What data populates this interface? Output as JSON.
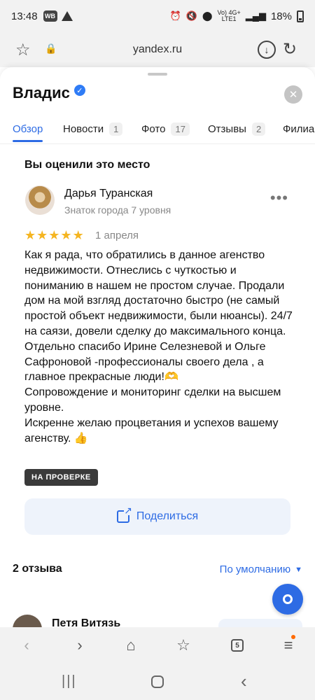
{
  "status_bar": {
    "time": "13:48",
    "app_badge": "WB",
    "network_label": "Vo) 4G+\nLTE1",
    "battery_percent": "18%"
  },
  "browser": {
    "url": "yandex.ru",
    "favorite_icon": "star-outline-icon",
    "lock_icon": "lock-icon",
    "download_icon": "download-icon",
    "reload_icon": "reload-icon"
  },
  "place": {
    "title": "Владис",
    "verified_icon": "verified-check-icon"
  },
  "tabs": [
    {
      "label": "Обзор",
      "count": "",
      "active": true
    },
    {
      "label": "Новости",
      "count": "1",
      "active": false
    },
    {
      "label": "Фото",
      "count": "17",
      "active": false
    },
    {
      "label": "Отзывы",
      "count": "2",
      "active": false
    },
    {
      "label": "Филиа",
      "count": "",
      "active": false
    }
  ],
  "my_review": {
    "heading": "Вы оценили это место",
    "author_name": "Дарья Туранская",
    "author_level": "Знаток города 7 уровня",
    "rating": 5,
    "date": "1 апреля",
    "text": "Как я рада, что обратились в данное агенство недвижимости. Отнеслись с чуткостью и пониманию в нашем не простом случае. Продали дом на мой взгляд достаточно быстро (не самый простой объект недвижимости, были нюансы). 24/7 на саязи, довели сделку до максимального конца. Отдельно спасибо Ирине Селезневой и Ольге Сафроновой -профессионалы своего дела , а главное прекрасные люди!🫶\nСопровождение и мониторинг сделки на высшем уровне.\nИскренне желаю процветания и успехов вашему агенству. 👍",
    "status_badge": "НА ПРОВЕРКЕ",
    "share_label": "Поделиться"
  },
  "reviews_section": {
    "count_label": "2 отзыва",
    "sort_label": "По умолчанию",
    "next_author": "Петя Витязь"
  },
  "colors": {
    "accent": "#2d6be4",
    "star": "#f5b521",
    "badge_bg": "#3a3a3a"
  }
}
